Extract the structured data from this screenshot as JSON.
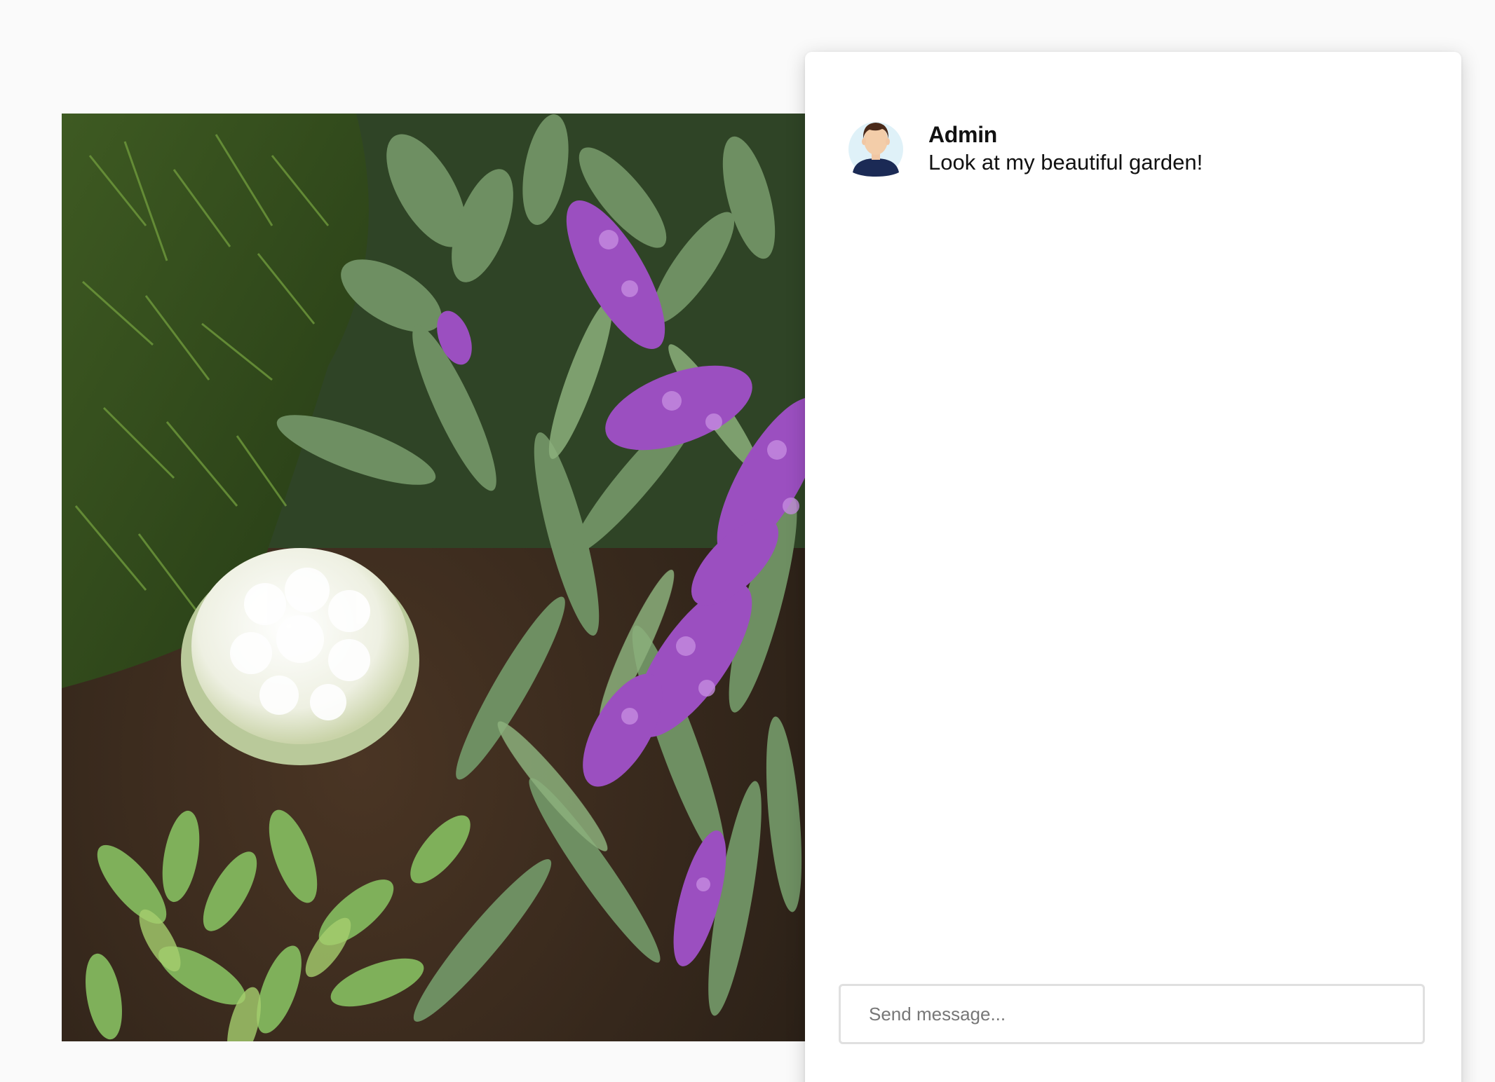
{
  "photo": {
    "icon": "garden-photo"
  },
  "chat": {
    "messages": [
      {
        "author": "Admin",
        "text": "Look at my beautiful garden!",
        "avatar_icon": "user-avatar-icon"
      }
    ],
    "composer": {
      "placeholder": "Send message...",
      "value": ""
    }
  },
  "colors": {
    "page_background": "#fafafa",
    "panel_background": "#ffffff",
    "input_border": "#e0e0e0",
    "avatar_shirt": "#1b2a55",
    "avatar_bg": "#dff1f8"
  }
}
